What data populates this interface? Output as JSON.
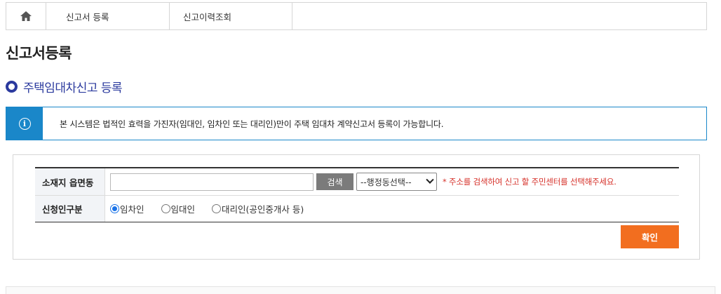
{
  "breadcrumb": {
    "home_icon": "home-icon",
    "items": [
      {
        "label": "신고서 등록"
      },
      {
        "label": "신고이력조회"
      }
    ]
  },
  "page_title": "신고서등록",
  "section_title": "주택임대차신고 등록",
  "notice": {
    "icon": "info-icon",
    "text": "본 시스템은 법적인 효력을 가진자(임대인, 임차인 또는 대리인)만이 주택 임대차 계약신고서 등록이 가능합니다."
  },
  "form": {
    "address": {
      "label": "소재지 읍면동",
      "value": "",
      "search_label": "검색",
      "select_value": "--행정동선택--",
      "hint": "* 주소를 검색하여 신고 할 주민센터를 선택해주세요."
    },
    "applicant": {
      "label": "신청인구분",
      "options": [
        {
          "label": "임차인",
          "checked": true
        },
        {
          "label": "임대인",
          "checked": false
        },
        {
          "label": "대리인(공인중개사 등)",
          "checked": false
        }
      ]
    },
    "confirm_label": "확인"
  },
  "colors": {
    "accent_blue": "#2b3a9e",
    "notice_blue": "#1a87c9",
    "confirm_orange": "#f26e1f",
    "hint_red": "#d6312a"
  }
}
